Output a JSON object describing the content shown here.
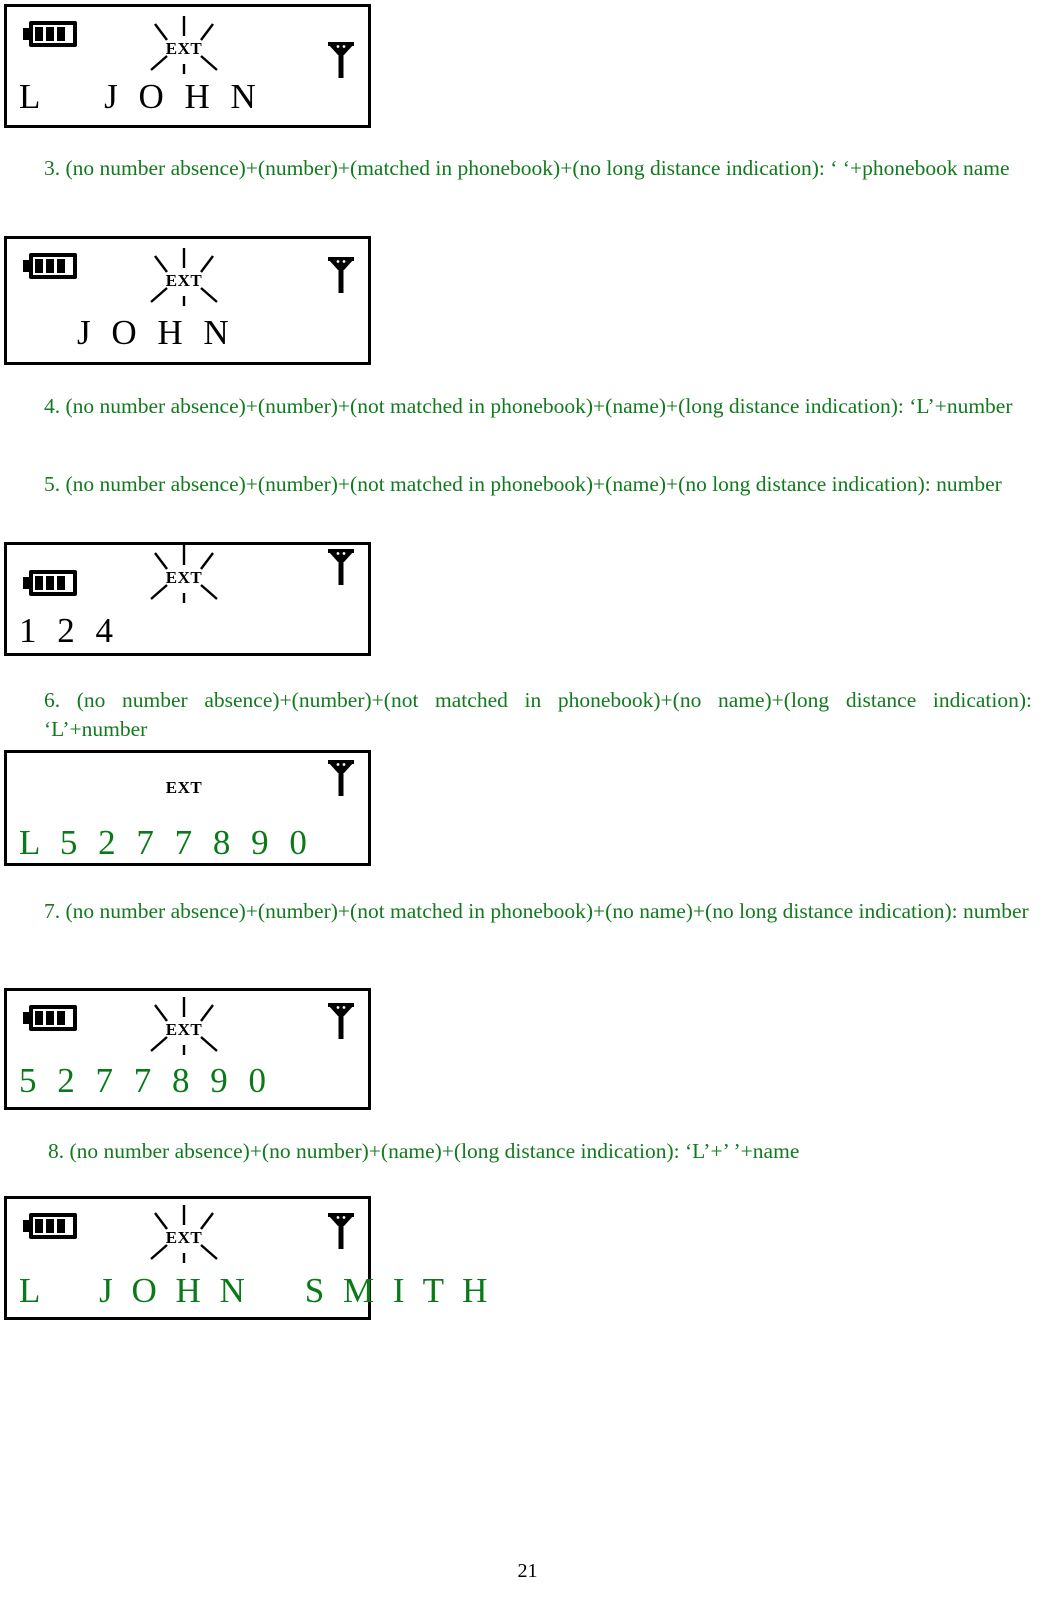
{
  "document": {
    "page_number": "21",
    "text_color": "#127a1e",
    "lcd_border_color": "#000000",
    "lcd_text_green": "#0a7a18",
    "lcd_text_black": "#000000"
  },
  "lcd_screens": [
    {
      "id": "screen-1",
      "battery_icon": "battery-icon",
      "battery_bars": 3,
      "show_battery": true,
      "ext_label": "EXT",
      "ext_rays": true,
      "antenna_icon": "antenna-icon",
      "display_text": "L    J O H N",
      "text_color_name": "black"
    },
    {
      "id": "screen-2",
      "battery_icon": "battery-icon",
      "battery_bars": 3,
      "show_battery": true,
      "ext_label": "EXT",
      "ext_rays": true,
      "antenna_icon": "antenna-icon",
      "display_text": "J O H N",
      "text_color_name": "black"
    },
    {
      "id": "screen-3",
      "battery_icon": "battery-icon",
      "battery_bars": 3,
      "show_battery": true,
      "ext_label": "EXT",
      "ext_rays": true,
      "antenna_icon": "antenna-icon",
      "display_text": "1 2 4",
      "text_color_name": "black"
    },
    {
      "id": "screen-4",
      "battery_icon": "battery-icon",
      "battery_bars": 3,
      "show_battery": false,
      "ext_label": "EXT",
      "ext_rays": false,
      "antenna_icon": "antenna-icon",
      "display_text": "L 5 2 7 7 8 9 0",
      "text_color_name": "green"
    },
    {
      "id": "screen-5",
      "battery_icon": "battery-icon",
      "battery_bars": 3,
      "show_battery": true,
      "ext_label": "EXT",
      "ext_rays": true,
      "antenna_icon": "antenna-icon",
      "display_text": "5 2 7 7 8 9 0",
      "text_color_name": "green"
    },
    {
      "id": "screen-6",
      "battery_icon": "battery-icon",
      "battery_bars": 3,
      "show_battery": true,
      "ext_label": "EXT",
      "ext_rays": true,
      "antenna_icon": "antenna-icon",
      "display_text": "L    J O H N    S M I T H",
      "text_color_name": "green"
    }
  ],
  "paragraphs": [
    {
      "id": "item-3",
      "text": "3. (no number absence)+(number)+(matched in phonebook)+(no long distance indication): ‘  ‘+phonebook name"
    },
    {
      "id": "item-4",
      "text": "4. (no number absence)+(number)+(not matched in phonebook)+(name)+(long distance indication): ‘L’+number"
    },
    {
      "id": "item-5",
      "text": "5. (no number absence)+(number)+(not matched in phonebook)+(name)+(no long distance indication): number"
    },
    {
      "id": "item-6",
      "text": "6. (no number absence)+(number)+(not matched in phonebook)+(no name)+(long distance indication): ‘L’+number"
    },
    {
      "id": "item-7",
      "text": "7. (no number absence)+(number)+(not matched in phonebook)+(no name)+(no long distance indication): number"
    },
    {
      "id": "item-8",
      "text": "8. (no number absence)+(no number)+(name)+(long distance indication): ‘L’+’ ’+name"
    }
  ]
}
